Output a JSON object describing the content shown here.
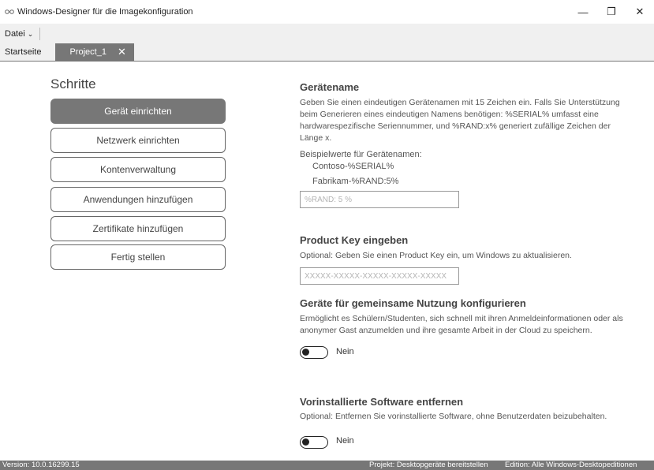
{
  "window": {
    "title": "Windows-Designer für die Imagekonfiguration",
    "icon": "app-glasses-icon",
    "minimize": "—",
    "restore": "❐",
    "close": "✕"
  },
  "menu": {
    "file_label": "Datei",
    "file_chevron": "⌄"
  },
  "tabs": [
    {
      "label": "Startseite"
    },
    {
      "label": "Project_1",
      "close": "✕"
    }
  ],
  "steps": {
    "title": "Schritte",
    "items": [
      {
        "label": "Gerät einrichten",
        "active": true
      },
      {
        "label": "Netzwerk einrichten"
      },
      {
        "label": "Kontenverwaltung"
      },
      {
        "label": "Anwendungen hinzufügen"
      },
      {
        "label": "Zertifikate hinzufügen"
      },
      {
        "label": "Fertig stellen"
      }
    ]
  },
  "device_name": {
    "title": "Gerätename",
    "description": "Geben Sie einen eindeutigen Gerätenamen mit 15 Zeichen ein. Falls Sie Unterstützung beim Generieren eines eindeutigen Namens benötigen: %SERIAL% umfasst eine hardwarespezifische Seriennummer, und %RAND:x% generiert zufällige Zeichen der Länge x.",
    "examples_label": "Beispielwerte für Gerätenamen:",
    "example1": "Contoso-%SERIAL%",
    "example2": "Fabrikam-%RAND:5%",
    "input_placeholder": "%RAND: 5 %",
    "input_value": ""
  },
  "product_key": {
    "title": "Product Key eingeben",
    "description": "Optional: Geben Sie einen Product Key ein, um Windows zu aktualisieren.",
    "input_placeholder": "XXXXX-XXXXX-XXXXX-XXXXX-XXXXX",
    "input_value": ""
  },
  "shared_use": {
    "title": "Geräte für gemeinsame Nutzung konfigurieren",
    "description": "Ermöglicht es Schülern/Studenten, sich schnell mit ihren Anmeldeinformationen oder als anonymer Gast anzumelden und ihre gesamte Arbeit in der Cloud zu speichern.",
    "toggle_label": "Nein",
    "toggle_on": false
  },
  "remove_software": {
    "title": "Vorinstallierte Software entfernen",
    "description": "Optional: Entfernen Sie vorinstallierte Software, ohne Benutzerdaten beizubehalten.",
    "toggle_label": "Nein",
    "toggle_on": false
  },
  "status": {
    "version": "Version: 10.0.16299.15",
    "project": "Projekt: Desktopgeräte bereitstellen",
    "edition": "Edition: Alle Windows-Desktopeditionen"
  },
  "colors": {
    "accent_gray": "#777777",
    "background": "#ffffff",
    "chrome": "#f0f0f0"
  }
}
